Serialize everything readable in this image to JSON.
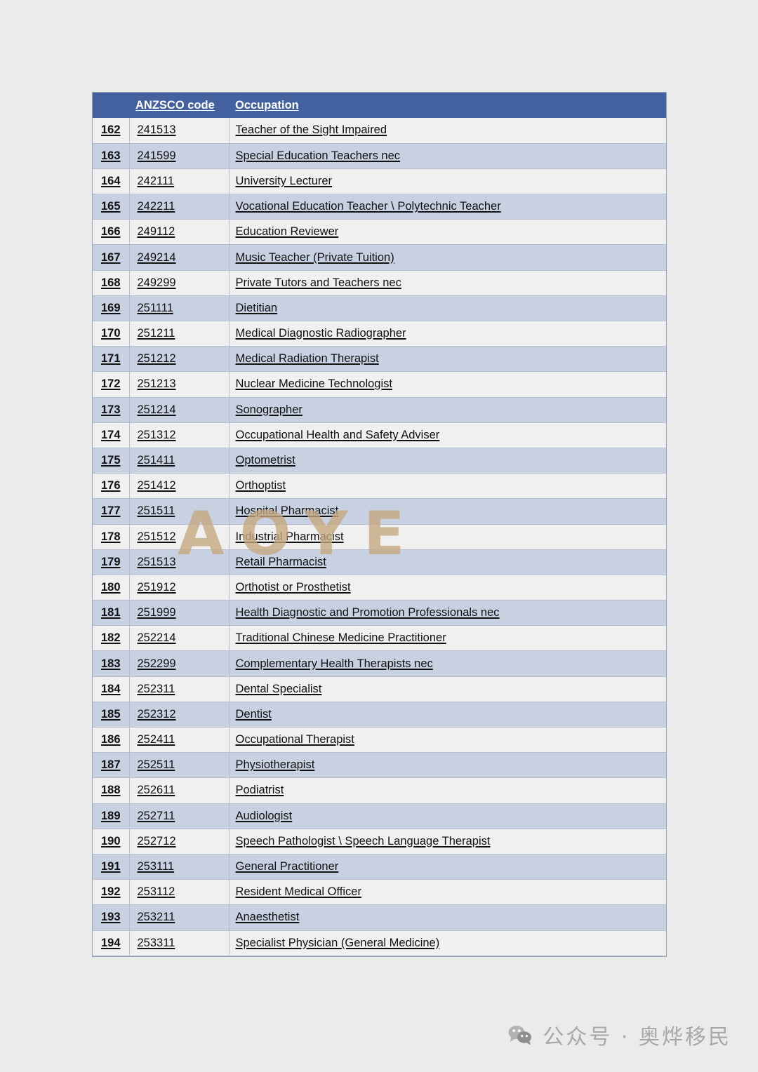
{
  "document": {
    "title": "ANZSCO Occupation List",
    "background_color": "#ebebeb"
  },
  "table": {
    "header_background": "#44619f",
    "header_text_color": "#ffffff",
    "band_light_color": "#eff0ef",
    "band_blue_color": "#c8d1e2",
    "border_color": "#b6bfd0",
    "columns": [
      {
        "key": "index",
        "label": ""
      },
      {
        "key": "code",
        "label": "ANZSCO code"
      },
      {
        "key": "occupation",
        "label": "Occupation"
      }
    ],
    "rows": [
      {
        "index": "162",
        "code": "241513",
        "occupation": "Teacher of the Sight Impaired"
      },
      {
        "index": "163",
        "code": "241599",
        "occupation": "Special Education Teachers nec"
      },
      {
        "index": "164",
        "code": "242111",
        "occupation": "University Lecturer"
      },
      {
        "index": "165",
        "code": "242211",
        "occupation": "Vocational Education Teacher \\ Polytechnic Teacher"
      },
      {
        "index": "166",
        "code": "249112",
        "occupation": "Education Reviewer"
      },
      {
        "index": "167",
        "code": "249214",
        "occupation": "Music Teacher (Private Tuition)"
      },
      {
        "index": "168",
        "code": "249299",
        "occupation": "Private Tutors and Teachers nec"
      },
      {
        "index": "169",
        "code": "251111",
        "occupation": "Dietitian"
      },
      {
        "index": "170",
        "code": "251211",
        "occupation": "Medical Diagnostic Radiographer"
      },
      {
        "index": "171",
        "code": "251212",
        "occupation": "Medical Radiation Therapist"
      },
      {
        "index": "172",
        "code": "251213",
        "occupation": "Nuclear Medicine Technologist"
      },
      {
        "index": "173",
        "code": "251214",
        "occupation": "Sonographer"
      },
      {
        "index": "174",
        "code": "251312",
        "occupation": "Occupational Health and Safety Adviser"
      },
      {
        "index": "175",
        "code": "251411",
        "occupation": "Optometrist"
      },
      {
        "index": "176",
        "code": "251412",
        "occupation": "Orthoptist"
      },
      {
        "index": "177",
        "code": "251511",
        "occupation": "Hospital Pharmacist"
      },
      {
        "index": "178",
        "code": "251512",
        "occupation": "Industrial Pharmacist"
      },
      {
        "index": "179",
        "code": "251513",
        "occupation": "Retail Pharmacist"
      },
      {
        "index": "180",
        "code": "251912",
        "occupation": "Orthotist or Prosthetist"
      },
      {
        "index": "181",
        "code": "251999",
        "occupation": "Health Diagnostic and Promotion Professionals nec"
      },
      {
        "index": "182",
        "code": "252214",
        "occupation": "Traditional Chinese Medicine Practitioner"
      },
      {
        "index": "183",
        "code": "252299",
        "occupation": "Complementary Health Therapists nec"
      },
      {
        "index": "184",
        "code": "252311",
        "occupation": "Dental Specialist"
      },
      {
        "index": "185",
        "code": "252312",
        "occupation": "Dentist"
      },
      {
        "index": "186",
        "code": "252411",
        "occupation": "Occupational Therapist"
      },
      {
        "index": "187",
        "code": "252511",
        "occupation": "Physiotherapist"
      },
      {
        "index": "188",
        "code": "252611",
        "occupation": "Podiatrist"
      },
      {
        "index": "189",
        "code": "252711",
        "occupation": "Audiologist"
      },
      {
        "index": "190",
        "code": "252712",
        "occupation": "Speech Pathologist \\ Speech Language Therapist"
      },
      {
        "index": "191",
        "code": "253111",
        "occupation": "General Practitioner"
      },
      {
        "index": "192",
        "code": "253112",
        "occupation": "Resident Medical Officer"
      },
      {
        "index": "193",
        "code": "253211",
        "occupation": "Anaesthetist"
      },
      {
        "index": "194",
        "code": "253311",
        "occupation": "Specialist Physician (General Medicine)"
      }
    ]
  },
  "watermark": {
    "text": "AOYE",
    "color": "#c6a87e"
  },
  "footer": {
    "icon": "wechat-icon",
    "text": "公众号 · 奥烨移民",
    "color": "#a8a8a8"
  }
}
